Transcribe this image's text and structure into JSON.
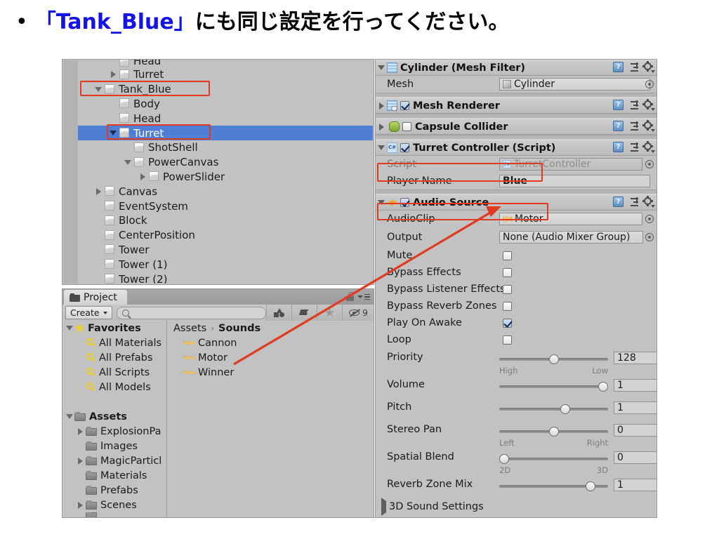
{
  "slide": {
    "bullet": "•",
    "title_quoted": "「Tank_Blue」",
    "title_rest": "にも同じ設定を行ってください。"
  },
  "hierarchy": {
    "rows": [
      {
        "label": "Head",
        "indent": 2,
        "twirl": "none",
        "clipped": true,
        "selected": false,
        "eye": false
      },
      {
        "label": "Turret",
        "indent": 2,
        "twirl": "closed",
        "clipped": false,
        "selected": false,
        "eye": false
      },
      {
        "label": "Tank_Blue",
        "indent": 1,
        "twirl": "open",
        "clipped": false,
        "selected": false,
        "eye": false
      },
      {
        "label": "Body",
        "indent": 2,
        "twirl": "none",
        "clipped": false,
        "selected": false,
        "eye": false
      },
      {
        "label": "Head",
        "indent": 2,
        "twirl": "none",
        "clipped": false,
        "selected": false,
        "eye": false
      },
      {
        "label": "Turret",
        "indent": 2,
        "twirl": "open",
        "clipped": false,
        "selected": true,
        "eye": true
      },
      {
        "label": "ShotShell",
        "indent": 3,
        "twirl": "none",
        "clipped": false,
        "selected": false,
        "eye": false
      },
      {
        "label": "PowerCanvas",
        "indent": 3,
        "twirl": "open",
        "clipped": false,
        "selected": false,
        "eye": false
      },
      {
        "label": "PowerSlider",
        "indent": 4,
        "twirl": "closed",
        "clipped": false,
        "selected": false,
        "eye": false
      },
      {
        "label": "Canvas",
        "indent": 1,
        "twirl": "closed",
        "clipped": false,
        "selected": false,
        "eye": false
      },
      {
        "label": "EventSystem",
        "indent": 1,
        "twirl": "none",
        "clipped": false,
        "selected": false,
        "eye": false
      },
      {
        "label": "Block",
        "indent": 1,
        "twirl": "none",
        "clipped": false,
        "selected": false,
        "eye": false
      },
      {
        "label": "CenterPosition",
        "indent": 1,
        "twirl": "none",
        "clipped": false,
        "selected": false,
        "eye": false
      },
      {
        "label": "Tower",
        "indent": 1,
        "twirl": "none",
        "clipped": false,
        "selected": false,
        "eye": false
      },
      {
        "label": "Tower (1)",
        "indent": 1,
        "twirl": "none",
        "clipped": false,
        "selected": false,
        "eye": false
      },
      {
        "label": "Tower (2)",
        "indent": 1,
        "twirl": "none",
        "clipped": false,
        "selected": false,
        "eye": false
      }
    ]
  },
  "project": {
    "tab_label": "Project",
    "create_label": "Create",
    "search_placeholder": "",
    "hidden_count": "9",
    "breadcrumb": {
      "root": "Assets",
      "separator": "›",
      "current": "Sounds"
    },
    "favorites": {
      "label": "Favorites",
      "items": [
        "All Materials",
        "All Prefabs",
        "All Scripts",
        "All Models"
      ]
    },
    "assets": {
      "label": "Assets",
      "items": [
        {
          "label": "ExplosionPa",
          "twirl": "closed"
        },
        {
          "label": "Images",
          "twirl": "none"
        },
        {
          "label": "MagicParticl",
          "twirl": "closed"
        },
        {
          "label": "Materials",
          "twirl": "none"
        },
        {
          "label": "Prefabs",
          "twirl": "none"
        },
        {
          "label": "Scenes",
          "twirl": "closed"
        }
      ]
    },
    "assets_in_folder": [
      "Cannon",
      "Motor",
      "Winner"
    ]
  },
  "inspector": {
    "components": [
      {
        "name": "mesh-filter",
        "title": "Cylinder (Mesh Filter)",
        "twirl": "open",
        "icon": "mesh-icon",
        "has_checkbox": false,
        "checked": false
      },
      {
        "name": "mesh-renderer",
        "title": "Mesh Renderer",
        "twirl": "closed",
        "icon": "mesh-renderer-icon",
        "has_checkbox": true,
        "checked": true
      },
      {
        "name": "capsule-collider",
        "title": "Capsule Collider",
        "twirl": "closed",
        "icon": "capsule-collider-icon",
        "has_checkbox": true,
        "checked": false
      },
      {
        "name": "turret-controller",
        "title": "Turret Controller (Script)",
        "twirl": "open",
        "icon": "csharp-script-icon",
        "has_checkbox": true,
        "checked": true
      },
      {
        "name": "audio-source",
        "title": "Audio Source",
        "twirl": "open",
        "icon": "audio-source-icon",
        "has_checkbox": true,
        "checked": true
      }
    ],
    "mesh_filter": {
      "mesh_label": "Mesh",
      "mesh_value": "Cylinder"
    },
    "turret_controller": {
      "script_label": "Script",
      "script_value": "TurretController",
      "player_name_label": "Player Name",
      "player_name_value": "Blue"
    },
    "audio_source": {
      "audioclip_label": "AudioClip",
      "audioclip_value": "Motor",
      "output_label": "Output",
      "output_value": "None (Audio Mixer Group)",
      "toggles": [
        {
          "label": "Mute",
          "checked": false
        },
        {
          "label": "Bypass Effects",
          "checked": false
        },
        {
          "label": "Bypass Listener Effects",
          "checked": false
        },
        {
          "label": "Bypass Reverb Zones",
          "checked": false
        },
        {
          "label": "Play On Awake",
          "checked": true
        },
        {
          "label": "Loop",
          "checked": false
        }
      ],
      "sliders": [
        {
          "label": "Priority",
          "value": "128",
          "knob_pct": 50,
          "left_label": "High",
          "right_label": "Low"
        },
        {
          "label": "Volume",
          "value": "1",
          "knob_pct": 100,
          "left_label": "",
          "right_label": ""
        },
        {
          "label": "Pitch",
          "value": "1",
          "knob_pct": 62,
          "left_label": "",
          "right_label": ""
        },
        {
          "label": "Stereo Pan",
          "value": "0",
          "knob_pct": 50,
          "left_label": "Left",
          "right_label": "Right"
        },
        {
          "label": "Spatial Blend",
          "value": "0",
          "knob_pct": 0,
          "left_label": "2D",
          "right_label": "3D"
        },
        {
          "label": "Reverb Zone Mix",
          "value": "1",
          "knob_pct": 87,
          "left_label": "",
          "right_label": ""
        }
      ],
      "sound_settings_label": "3D Sound Settings"
    }
  },
  "colors": {
    "highlight_box": "#e03a20",
    "selection_blue": "#4e7fd4",
    "title_blue": "#1414e6",
    "panel_bg": "#c2c2c2"
  }
}
